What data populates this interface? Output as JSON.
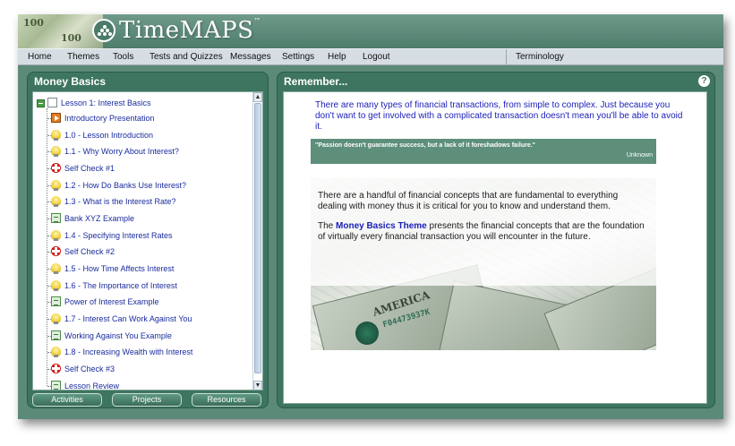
{
  "app": {
    "title": "TimeMAPS",
    "trademark": "™"
  },
  "header": {
    "bill_text": "100"
  },
  "menu": {
    "items": [
      "Home",
      "Themes",
      "Tools",
      "Tests and Quizzes",
      "Messages",
      "Settings",
      "Help",
      "Logout"
    ],
    "terminology": "Terminology"
  },
  "left_panel": {
    "title": "Money Basics",
    "tree": {
      "lesson": "Lesson 1: Interest Basics",
      "items": [
        {
          "icon": "presentation",
          "label": "Introductory Presentation"
        },
        {
          "icon": "bulb",
          "label": "1.0 - Lesson Introduction"
        },
        {
          "icon": "bulb",
          "label": "1.1 - Why Worry About Interest?"
        },
        {
          "icon": "check",
          "label": "Self Check #1"
        },
        {
          "icon": "bulb",
          "label": "1.2 - How Do Banks Use Interest?"
        },
        {
          "icon": "bulb",
          "label": "1.3 - What is the Interest Rate?"
        },
        {
          "icon": "example",
          "label": "Bank XYZ Example"
        },
        {
          "icon": "bulb",
          "label": "1.4 - Specifying Interest Rates"
        },
        {
          "icon": "check",
          "label": "Self Check #2"
        },
        {
          "icon": "bulb",
          "label": "1.5 - How Time Affects Interest"
        },
        {
          "icon": "bulb",
          "label": "1.6 - The Importance of Interest"
        },
        {
          "icon": "example",
          "label": "Power of Interest Example"
        },
        {
          "icon": "bulb",
          "label": "1.7 - Interest Can Work Against You"
        },
        {
          "icon": "example",
          "label": "Working Against You Example"
        },
        {
          "icon": "bulb",
          "label": "1.8 - Increasing Wealth with Interest"
        },
        {
          "icon": "check",
          "label": "Self Check #3"
        },
        {
          "icon": "example",
          "label": "Lesson Review"
        }
      ]
    },
    "buttons": [
      "Activities",
      "Projects",
      "Resources"
    ]
  },
  "right_panel": {
    "title": "Remember...",
    "help": "?",
    "intro": "There are many types of financial transactions, from simple to complex. Just because you don't want to get involved with a complicated transaction doesn't mean you'll be able to avoid it.",
    "quote": "\"Passion doesn't guarantee success, but a lack of it foreshadows failure.\"",
    "quote_author": "Unknown",
    "para1": "There are a handful of financial concepts that are fundamental to everything dealing with money thus it is critical for you to know and understand them.",
    "para2_prefix": "The ",
    "para2_link": "Money Basics Theme",
    "para2_suffix": " presents the financial concepts that are the foundation of virtually every financial transaction you will encounter in the future.",
    "bill_serial": "F04473937K",
    "bill_word": "AMERICA"
  }
}
